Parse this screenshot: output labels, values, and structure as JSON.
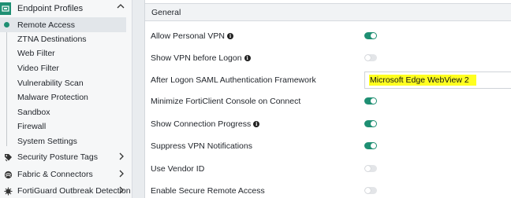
{
  "sidebar": {
    "group": {
      "label": "Endpoint Profiles"
    },
    "sub_items": [
      {
        "label": "Remote Access",
        "active": true
      },
      {
        "label": "ZTNA Destinations"
      },
      {
        "label": "Web Filter"
      },
      {
        "label": "Video Filter"
      },
      {
        "label": "Vulnerability Scan"
      },
      {
        "label": "Malware Protection"
      },
      {
        "label": "Sandbox"
      },
      {
        "label": "Firewall"
      },
      {
        "label": "System Settings"
      }
    ],
    "nav_items": [
      {
        "label": "Security Posture Tags",
        "icon": "tag-icon"
      },
      {
        "label": "Fabric & Connectors",
        "icon": "fabric-icon"
      },
      {
        "label": "FortiGuard Outbreak Detection",
        "icon": "outbreak-icon"
      }
    ]
  },
  "main": {
    "section_title": "General",
    "settings": [
      {
        "label": "Allow Personal VPN",
        "info": true,
        "type": "toggle",
        "state": "on"
      },
      {
        "label": "Show VPN before Logon",
        "info": true,
        "type": "toggle",
        "state": "off"
      },
      {
        "label": "After Logon SAML Authentication Framework",
        "info": false,
        "type": "select",
        "value": "Microsoft Edge WebView 2"
      },
      {
        "label": "Minimize FortiClient Console on Connect",
        "info": false,
        "type": "toggle",
        "state": "on"
      },
      {
        "label": "Show Connection Progress",
        "info": true,
        "type": "toggle",
        "state": "on"
      },
      {
        "label": "Suppress VPN Notifications",
        "info": false,
        "type": "toggle",
        "state": "on"
      },
      {
        "label": "Use Vendor ID",
        "info": false,
        "type": "toggle",
        "state": "off"
      },
      {
        "label": "Enable Secure Remote Access",
        "info": false,
        "type": "toggle",
        "state": "off"
      }
    ]
  },
  "colors": {
    "accent": "#1f8f73",
    "highlight": "#ffff20"
  }
}
